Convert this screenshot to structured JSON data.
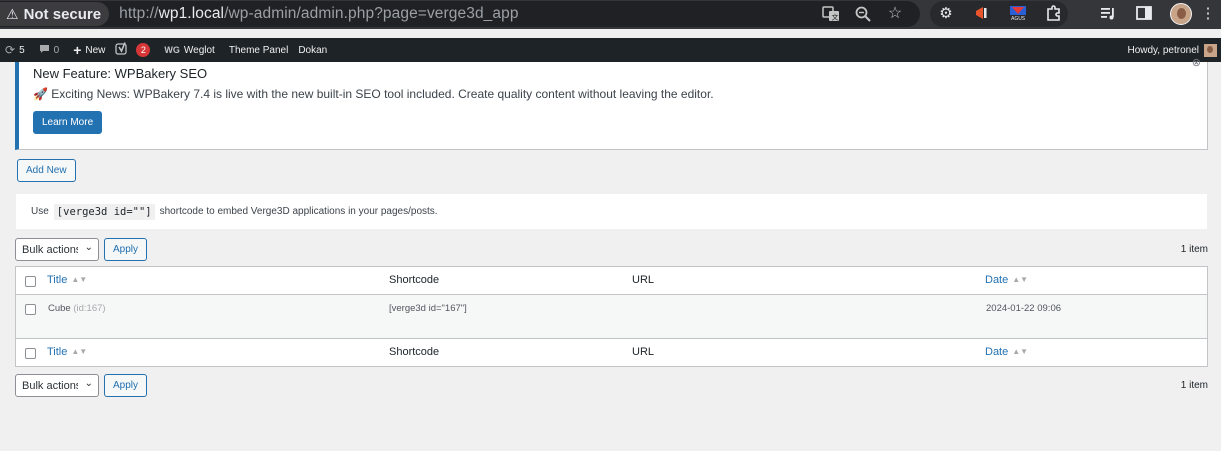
{
  "browser": {
    "security_label": "Not secure",
    "url_scheme": "http://",
    "url_host": "wp1.local",
    "url_path": "/wp-admin/admin.php?page=verge3d_app"
  },
  "adminbar": {
    "updates_count": "5",
    "comments_count": "0",
    "new_label": "New",
    "yoast_badge": "2",
    "weglot_label": "Weglot",
    "theme_panel_label": "Theme Panel",
    "dokan_label": "Dokan",
    "howdy": "Howdy, petronel"
  },
  "notice": {
    "title": "New Feature: WPBakery SEO",
    "message": "🚀 Exciting News: WPBakery 7.4 is live with the new built-in SEO tool included. Create quality content without leaving the editor.",
    "button": "Learn More"
  },
  "add_new_label": "Add New",
  "info": {
    "prefix": "Use",
    "code": "[verge3d id=\"\"]",
    "suffix": "shortcode to embed Verge3D applications in your pages/posts."
  },
  "tablenav": {
    "bulk_label": "Bulk actions",
    "apply_label": "Apply",
    "count": "1 item"
  },
  "table": {
    "columns": {
      "title": "Title",
      "shortcode": "Shortcode",
      "url": "URL",
      "date": "Date"
    },
    "rows": [
      {
        "title": "Cube",
        "id_label": "(id:167)",
        "shortcode": "[verge3d id=\"167\"]",
        "url": "",
        "date": "2024-01-22 09:06"
      }
    ]
  }
}
